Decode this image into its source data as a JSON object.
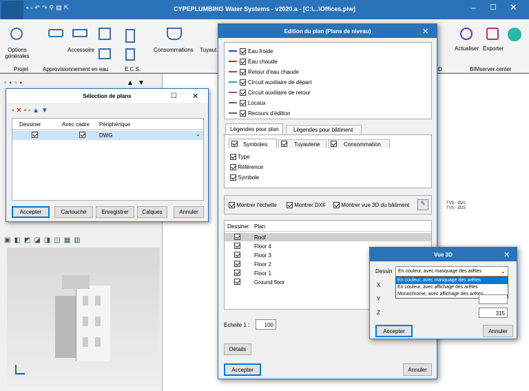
{
  "app": {
    "title": "CYPEPLUMBING Water Systems - v2020.a - [C:\\...\\Offices.plw]"
  },
  "ribbon": {
    "options_label": "Options\ngénérales",
    "projet": "Projet",
    "accessoire": "Accessoire",
    "appro": "Approvisionnement en eau",
    "ecs": "E.C.S.",
    "consommations": "Consommations",
    "tuyau": "Tuyaut",
    "actualiser": "Actualiser",
    "exporter": "Exporter",
    "bimserver": "BIMserver.center",
    "d_label": "D"
  },
  "selection": {
    "title": "Sélection de plans",
    "headers": [
      "Dessiner",
      "Avec cadre",
      "Périphérique"
    ],
    "row": {
      "device": "DWG"
    },
    "buttons": [
      "Accepter",
      "Cartouche",
      "Enregistrer",
      "Calques",
      "Annuler"
    ]
  },
  "edition": {
    "title": "Edition du plan (Plans de niveau)",
    "layers": [
      {
        "label": "Eau froide",
        "color": "#2040c0"
      },
      {
        "label": "Eau chaude",
        "color": "#d02020"
      },
      {
        "label": "Retour d'eau chaude",
        "color": "#d02080"
      },
      {
        "label": "Circuit auxiliaire de départ",
        "color": "#30a0a0"
      },
      {
        "label": "Circuit auxiliaire de retour",
        "color": "#a050a0"
      },
      {
        "label": "Locaux",
        "color": "#606060"
      },
      {
        "label": "Recours d'édition",
        "color": "#606060"
      }
    ],
    "tabs": [
      "Légendes pour plan",
      "Légendes pour bâtiment"
    ],
    "subtabs": [
      "Symboles",
      "Tuyauterie",
      "Consommation"
    ],
    "symbol_opts": [
      "Type",
      "Référence",
      "Symbole"
    ],
    "show_opts": [
      "Montrer l'échelle",
      "Montrer DXF",
      "Montrer vue 3D du bâtiment"
    ],
    "plan_headers": [
      "Dessiner",
      "Plan"
    ],
    "plans": [
      "Roof",
      "Floor 4",
      "Floor 3",
      "Floor 2",
      "Floor 1",
      "Ground floor"
    ],
    "echelle_label": "Échelle 1 :",
    "echelle_value": "100",
    "details": "Détails",
    "accepter": "Accepter",
    "annuler": "Annuler"
  },
  "vue3d": {
    "title": "Vue 3D",
    "dessin_label": "Dessin",
    "selected": "En couleur, avec masquage des arêtes",
    "options": [
      "En couleur, avec masquage des arêtes",
      "En couleur, avec affichage des arêtes",
      "Monochrome, avec affichage des arêtes"
    ],
    "x_label": "X",
    "y_label": "Y",
    "z_label": "Z",
    "z_value": "315",
    "accepter": "Accepter",
    "annuler": "Annuler"
  },
  "drawing": {
    "tv1": "TV9 - Ø20",
    "tv2": "TV5 - Ø25"
  }
}
